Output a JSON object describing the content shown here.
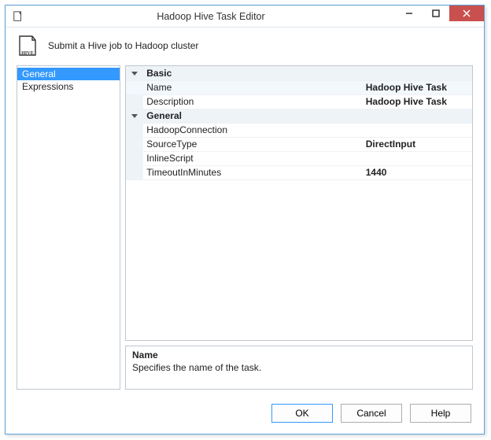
{
  "window": {
    "title": "Hadoop Hive Task Editor"
  },
  "header": {
    "subtitle": "Submit a Hive job to Hadoop cluster",
    "icon_label": "HIVE"
  },
  "nav": {
    "items": [
      {
        "label": "General",
        "selected": true
      },
      {
        "label": "Expressions",
        "selected": false
      }
    ]
  },
  "propgrid": {
    "sections": [
      {
        "label": "Basic",
        "rows": [
          {
            "name": "Name",
            "value": "Hadoop Hive Task",
            "bold": true,
            "selected": true
          },
          {
            "name": "Description",
            "value": "Hadoop Hive Task",
            "bold": true,
            "selected": false
          }
        ]
      },
      {
        "label": "General",
        "rows": [
          {
            "name": "HadoopConnection",
            "value": "",
            "bold": false,
            "selected": false
          },
          {
            "name": "SourceType",
            "value": "DirectInput",
            "bold": true,
            "selected": false
          },
          {
            "name": "InlineScript",
            "value": "",
            "bold": false,
            "selected": false
          },
          {
            "name": "TimeoutInMinutes",
            "value": "1440",
            "bold": true,
            "selected": false
          }
        ]
      }
    ]
  },
  "description": {
    "title": "Name",
    "text": "Specifies the name of the task."
  },
  "footer": {
    "ok": "OK",
    "cancel": "Cancel",
    "help": "Help"
  }
}
